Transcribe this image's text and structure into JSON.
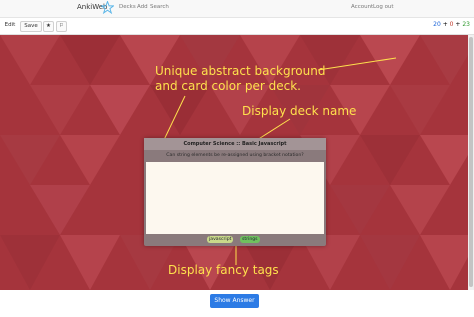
{
  "nav": {
    "brand": "AnkiWeb",
    "decks": "Decks",
    "add": "Add",
    "search": "Search",
    "account": "Account",
    "logout": "Log out"
  },
  "toolbar": {
    "edit": "Edit",
    "save": "Save",
    "star": "★",
    "flag": "⚐"
  },
  "counts": {
    "new": "20",
    "plus1": "+",
    "learn": "0",
    "plus2": "+",
    "review": "23"
  },
  "annotations": {
    "background_line1": "Unique abstract background",
    "background_line2": "and card color per deck.",
    "deck_name": "Display deck name",
    "tags": "Display fancy tags"
  },
  "card": {
    "deck_title": "Computer Science :: Basic Javascript",
    "question": "Can string elements be re-assigned using bracket notation?",
    "tags": [
      "javascript",
      "strings"
    ]
  },
  "show_answer": "Show Answer",
  "colors": {
    "background": "#a5343c",
    "annotation": "#ffe14d",
    "card_frame": "#8a7a7c",
    "card_body": "#fdf8ef",
    "button": "#2c7be5"
  }
}
